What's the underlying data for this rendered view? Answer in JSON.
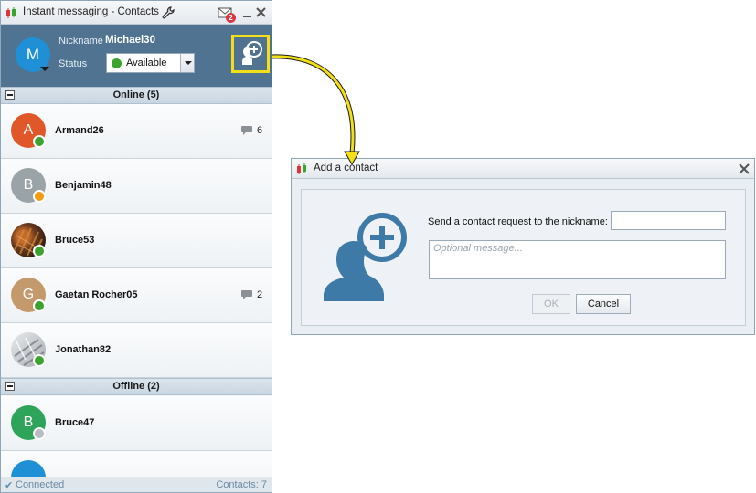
{
  "contacts_window": {
    "title": "Instant messaging - Contacts",
    "mail_badge": "2",
    "profile": {
      "avatar_letter": "M",
      "nickname_label": "Nickname",
      "nickname": "Michael30",
      "status_label": "Status",
      "status_value": "Available"
    },
    "groups": [
      {
        "title": "Online (5)",
        "contacts": [
          {
            "name": "Armand26",
            "avatar_letter": "A",
            "avatar_color": "#e0582a",
            "status": "online",
            "unread": "6"
          },
          {
            "name": "Benjamin48",
            "avatar_letter": "B",
            "avatar_color": "#9aa3a8",
            "status": "away",
            "unread": ""
          },
          {
            "name": "Bruce53",
            "avatar_letter": "",
            "avatar_color": "#5a3b24",
            "status": "online",
            "unread": ""
          },
          {
            "name": "Gaetan Rocher05",
            "avatar_letter": "G",
            "avatar_color": "#c49a6c",
            "status": "online",
            "unread": "2"
          },
          {
            "name": "Jonathan82",
            "avatar_letter": "",
            "avatar_color": "#c9ccd0",
            "status": "online",
            "unread": ""
          }
        ]
      },
      {
        "title": "Offline (2)",
        "contacts": [
          {
            "name": "Bruce47",
            "avatar_letter": "B",
            "avatar_color": "#2ea35a",
            "status": "offline",
            "unread": ""
          }
        ]
      }
    ],
    "status_bar": {
      "connected": "Connected",
      "contacts_count": "Contacts: 7"
    }
  },
  "dialog": {
    "title": "Add a contact",
    "prompt": "Send a contact request to the nickname:",
    "nickname_value": "",
    "message_placeholder": "Optional message...",
    "ok_label": "OK",
    "cancel_label": "Cancel"
  },
  "colors": {
    "profile_bg": "#4f7390",
    "highlight": "#f2df18",
    "status_online": "#3aa42e",
    "status_away": "#f39c12",
    "status_offline": "#b7bcc1",
    "icon_blue": "#3d7aa8"
  }
}
